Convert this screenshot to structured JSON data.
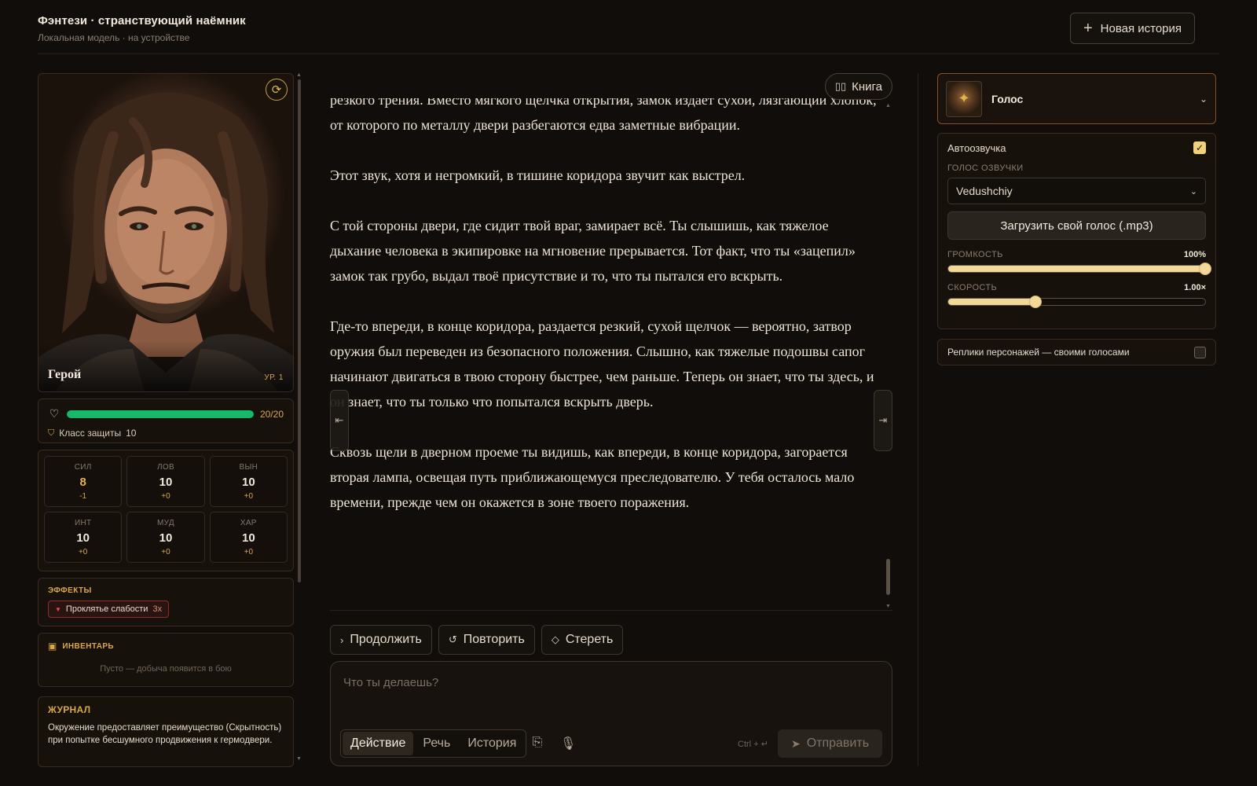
{
  "header": {
    "title": "Фэнтези · странствующий наёмник",
    "subtitle": "Локальная модель · на устройстве",
    "new_story_label": "Новая история"
  },
  "character": {
    "name": "Герой",
    "level": "УР. 1",
    "hp_text": "20/20",
    "hp_fraction": 1.0,
    "armor_label": "Класс защиты",
    "armor_value": "10",
    "stats": [
      {
        "name": "СИЛ",
        "value": "8",
        "mod": "-1"
      },
      {
        "name": "ЛОВ",
        "value": "10",
        "mod": "+0"
      },
      {
        "name": "ВЫН",
        "value": "10",
        "mod": "+0"
      },
      {
        "name": "ИНТ",
        "value": "10",
        "mod": "+0"
      },
      {
        "name": "МУД",
        "value": "10",
        "mod": "+0"
      },
      {
        "name": "ХАР",
        "value": "10",
        "mod": "+0"
      }
    ]
  },
  "effects": {
    "label": "ЭФФЕКТЫ",
    "items": [
      {
        "name": "Проклятье слабости",
        "count": "3x"
      }
    ]
  },
  "inventory": {
    "label": "ИНВЕНТАРЬ",
    "empty_text": "Пусто — добыча появится в бою"
  },
  "journal": {
    "title": "ЖУРНАЛ",
    "text": "Окружение предоставляет преимущество (Скрытность) при попытке бесшумного продвижения к гермодвери."
  },
  "story": {
    "book_label": "Книга",
    "paragraphs": [
      "резкого трения. Вместо мягкого щелчка открытия, замок издаёт сухой, лязгающий хлопок, от которого по металлу двери разбегаются едва заметные вибрации.",
      "Этот звук, хотя и негромкий, в тишине коридора звучит как выстрел.",
      "С той стороны двери, где сидит твой враг, замирает всё. Ты слышишь, как тяжелое дыхание человека в экипировке на мгновение прерывается. Тот факт, что ты «зацепил» замок так грубо, выдал твоё присутствие и то, что ты пытался его вскрыть.",
      "Где-то впереди, в конце коридора, раздается резкий, сухой щелчок — вероятно, затвор оружия был переведен из безопасного положения. Слышно, как тяжелые подошвы сапог начинают двигаться в твою сторону быстрее, чем раньше. Теперь он знает, что ты здесь, и он знает, что ты только что попытался вскрыть дверь.",
      "Сквозь щели в дверном проеме ты видишь, как впереди, в конце коридора, загорается вторая лампа, освещая путь приближающемуся преследователю. У тебя осталось мало времени, прежде чем он окажется в зоне твоего поражения."
    ]
  },
  "actions": {
    "continue": "Продолжить",
    "retry": "Повторить",
    "erase": "Стереть"
  },
  "composer": {
    "placeholder": "Что ты делаешь?",
    "modes": [
      "Действие",
      "Речь",
      "История"
    ],
    "active_mode": "Действие",
    "shortcut": "Ctrl + ↵",
    "send_label": "Отправить"
  },
  "voice": {
    "title": "Голос",
    "autoplay_label": "Автоозвучка",
    "autoplay_checked": true,
    "voice_label": "ГОЛОС ОЗВУЧКИ",
    "voice_value": "Vedushchiy",
    "upload_label": "Загрузить свой голос (.mp3)",
    "volume_label": "ГРОМКОСТЬ",
    "volume_value": "100%",
    "volume_fraction": 1.0,
    "speed_label": "СКОРОСТЬ",
    "speed_value": "1.00×",
    "speed_fraction": 0.34,
    "replicas_label": "Реплики персонажей — своими голосами",
    "replicas_checked": false
  },
  "colors": {
    "accent": "#d9a74a",
    "hp": "#18b86a",
    "background": "#110d0a",
    "slider": "#f2d899",
    "effect_border": "#8c2c2c"
  }
}
